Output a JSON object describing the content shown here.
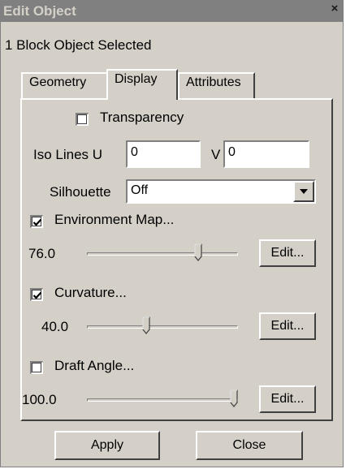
{
  "window": {
    "title": "Edit Object",
    "close_glyph": "×"
  },
  "subtitle": "1 Block Object Selected",
  "tabs": [
    {
      "label": "Geometry",
      "active": false
    },
    {
      "label": "Display",
      "active": true
    },
    {
      "label": "Attributes",
      "active": false
    }
  ],
  "display": {
    "transparency": {
      "label": "Transparency",
      "checked": false
    },
    "iso_lines": {
      "u_label": "Iso Lines U",
      "u_value": "0",
      "v_label": "V",
      "v_value": "0"
    },
    "silhouette": {
      "label": "Silhouette",
      "value": "Off"
    },
    "environment_map": {
      "label": "Environment Map...",
      "checked": true,
      "value": "76.0",
      "slider_fraction": 0.76,
      "edit_label": "Edit..."
    },
    "curvature": {
      "label": "Curvature...",
      "checked": true,
      "value": "40.0",
      "slider_fraction": 0.4,
      "edit_label": "Edit..."
    },
    "draft_angle": {
      "label": "Draft Angle...",
      "checked": false,
      "value": "100.0",
      "slider_fraction": 1.0,
      "edit_label": "Edit..."
    }
  },
  "buttons": {
    "apply": "Apply",
    "close": "Close"
  }
}
